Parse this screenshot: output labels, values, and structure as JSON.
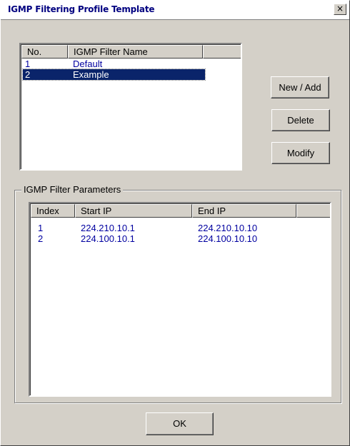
{
  "window": {
    "title": "IGMP Filtering Profile Template",
    "close_label": "×"
  },
  "profiles": {
    "headers": [
      "No.",
      "IGMP Filter Name",
      ""
    ],
    "rows": [
      {
        "no": "1",
        "name": "Default"
      },
      {
        "no": "2",
        "name": "Example"
      }
    ],
    "selected_index": 1
  },
  "buttons": {
    "new_add": "New / Add",
    "delete": "Delete",
    "modify": "Modify",
    "ok": "OK"
  },
  "parameters": {
    "group_label": "IGMP Filter Parameters",
    "headers": [
      "Index",
      "Start IP",
      "End IP",
      ""
    ],
    "rows": [
      {
        "index": "1",
        "start_ip": "224.210.10.1",
        "end_ip": "224.210.10.10"
      },
      {
        "index": "2",
        "start_ip": "224.100.10.1",
        "end_ip": "224.100.10.10"
      }
    ]
  },
  "colors": {
    "window_bg": "#d4d0c8",
    "selection_bg": "#0a246a",
    "row_text": "#0000a0",
    "title_text": "#000080"
  }
}
